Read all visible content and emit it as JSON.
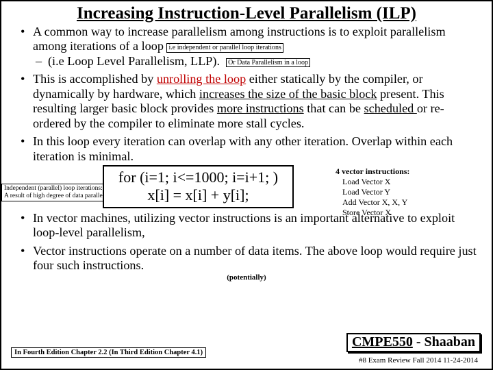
{
  "title": "Increasing Instruction-Level Parallelism (ILP)",
  "bullets": {
    "b1a": "A common way to increase parallelism among instructions is to exploit parallelism among iterations of a loop",
    "annot1": "i.e independent or parallel loop iterations",
    "sub1": "(i.e  Loop Level Parallelism, LLP).",
    "annot2": "Or Data Parallelism in a loop",
    "b2a": "This is accomplished by ",
    "b2link": "unrolling the loop",
    "b2b": " either statically by the compiler, or dynamically by hardware,  which ",
    "b2u1": "increases the size of the basic block",
    "b2c": " present.  This resulting larger basic block provides ",
    "b2u2": "more instructions",
    "b2d": " that can be ",
    "b2u3": "scheduled ",
    "b2e": "or re-ordered by the compiler to eliminate more stall cycles.",
    "b3": "In this loop every iteration can overlap with any other iteration. Overlap within each iteration is minimal.",
    "b4": "In vector machines, utilizing vector instructions is an important alternative to exploit loop-level parallelism,",
    "b5": "Vector instructions operate on a number of data items.  The above loop would require just  four such instructions."
  },
  "code": {
    "l1": "for (i=1; i<=1000; i=i+1; )",
    "l2": "x[i] = x[i] + y[i];"
  },
  "leftnote": {
    "l1": "Independent (parallel) loop iterations:",
    "l2": "A result of high degree of data parallelism"
  },
  "vec": {
    "head": "4 vector instructions:",
    "i1": "Load Vector X",
    "i2": "Load Vector Y",
    "i3": "Add Vector X, X, Y",
    "i4": "Store Vector X"
  },
  "potentially": "(potentially)",
  "course": {
    "c1": "CMPE550",
    "dash": " - ",
    "c2": "Shaaban"
  },
  "chapref": "In Fourth Edition Chapter 2.2 (In Third Edition Chapter 4.1)",
  "footer": "#8    Exam Review   Fall 2014   11-24-2014"
}
